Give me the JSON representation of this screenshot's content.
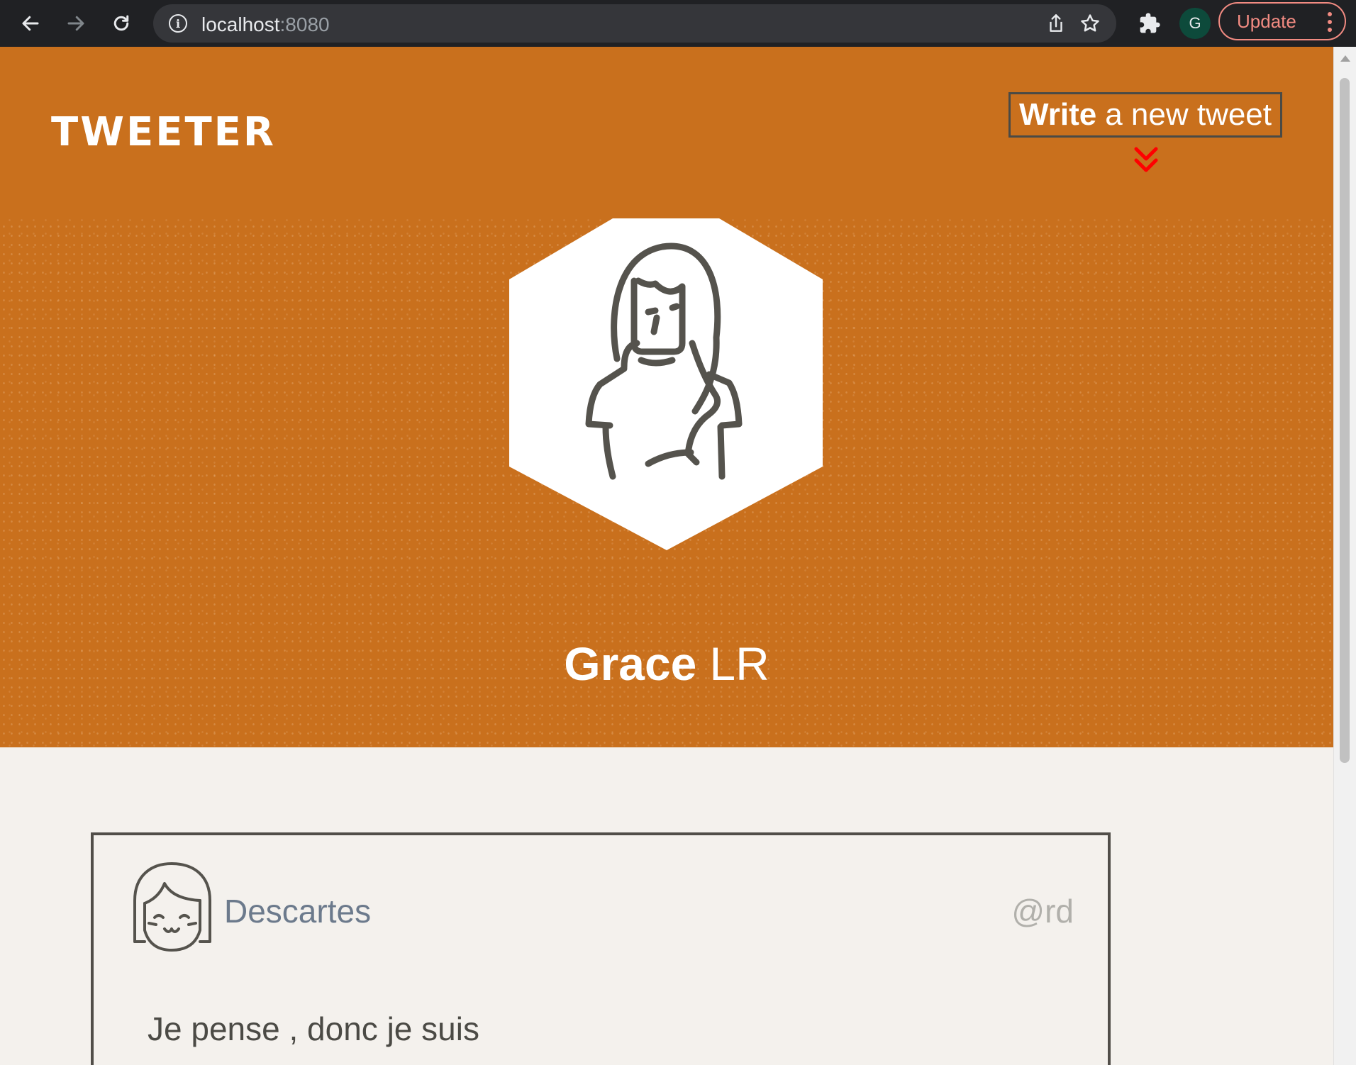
{
  "browser": {
    "url_host": "localhost",
    "url_port": ":8080",
    "profile_initial": "G",
    "update_label": "Update"
  },
  "site": {
    "brand": "TWEETER",
    "compose_bold": "Write",
    "compose_rest": "a new tweet",
    "compose_arrow_color": "#ff0000",
    "header_color": "#c9701d"
  },
  "profile": {
    "first_name": "Grace",
    "last_name": "LR"
  },
  "tweets": [
    {
      "name": "Descartes",
      "handle": "@rd",
      "text": "Je pense , donc je suis"
    }
  ]
}
